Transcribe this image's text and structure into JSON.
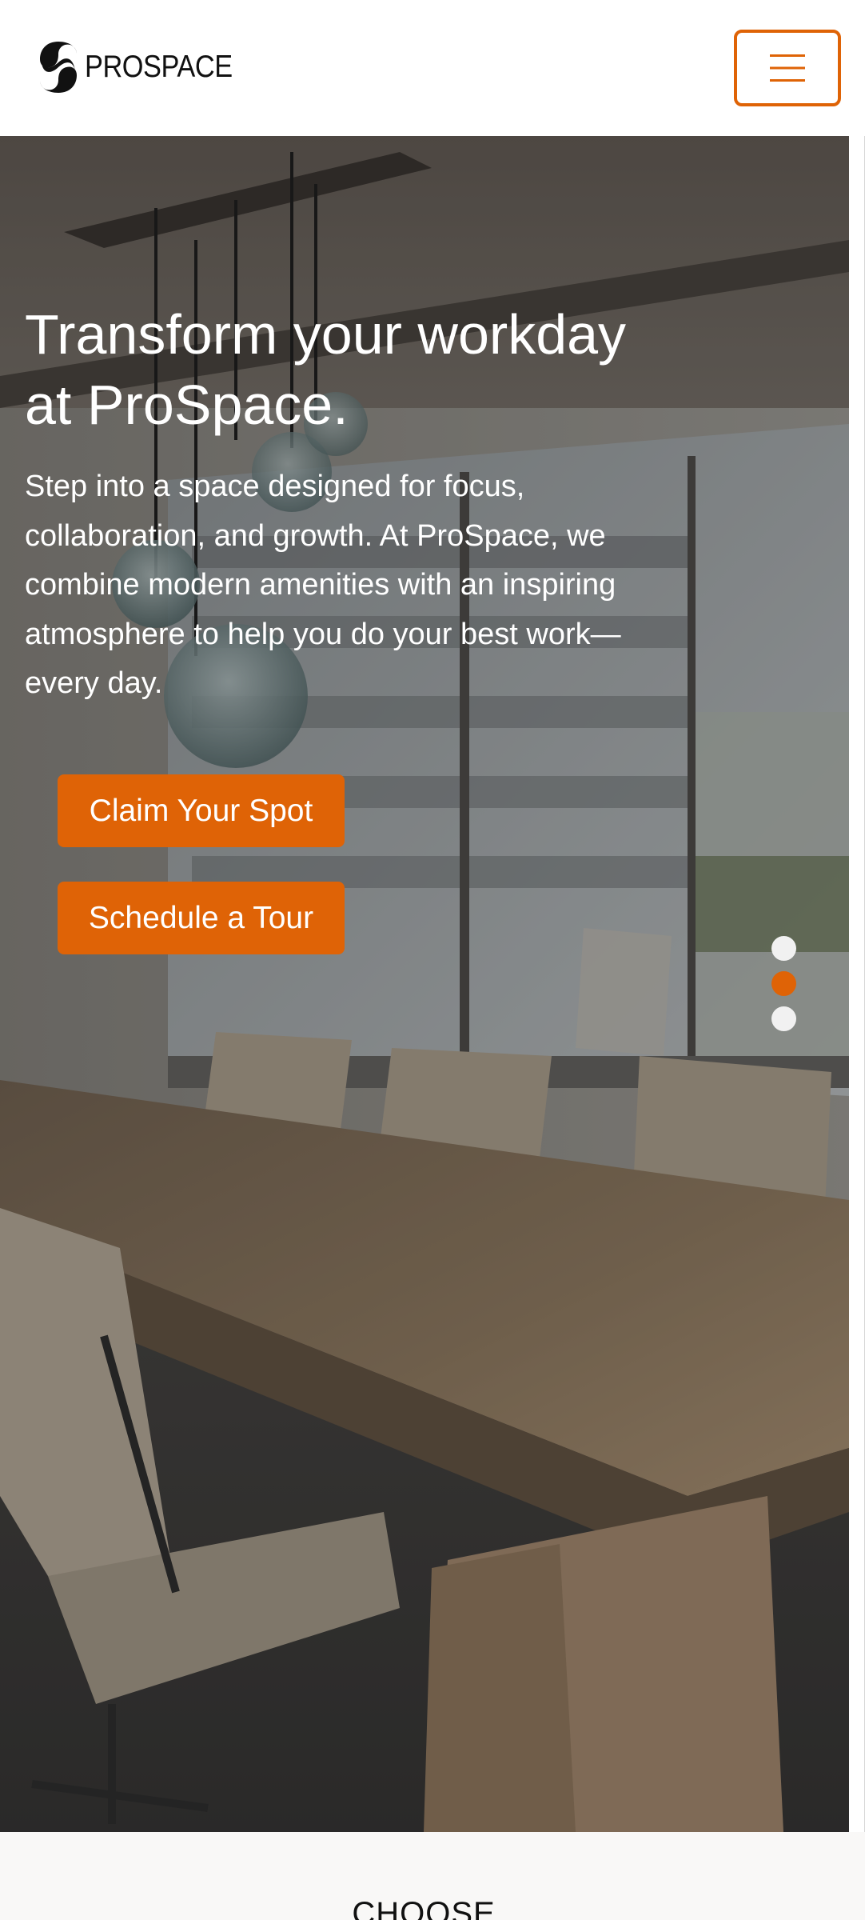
{
  "header": {
    "brand": "PROSPACE",
    "logo_icon": "prospace-swirl-logo",
    "menu_icon": "hamburger-menu-icon"
  },
  "hero": {
    "title": "Transform your workday at ProSpace.",
    "description": "Step into a space designed for focus, collaboration, and growth. At ProSpace, we combine modern amenities with an inspiring atmosphere to help you do your best work—every day.",
    "primary_cta": "Claim Your Spot",
    "secondary_cta": "Schedule a Tour",
    "background_image": "conference room with wooden table, office chairs and glass pendant lights",
    "carousel": {
      "slides": 3,
      "active_slide": 2
    }
  },
  "next_section": {
    "heading": "CHOOSE"
  },
  "colors": {
    "accent": "#df6306",
    "dot_inactive": "#f1f1f1",
    "text_dark": "#111111",
    "section_bg": "#f9f8f7"
  }
}
